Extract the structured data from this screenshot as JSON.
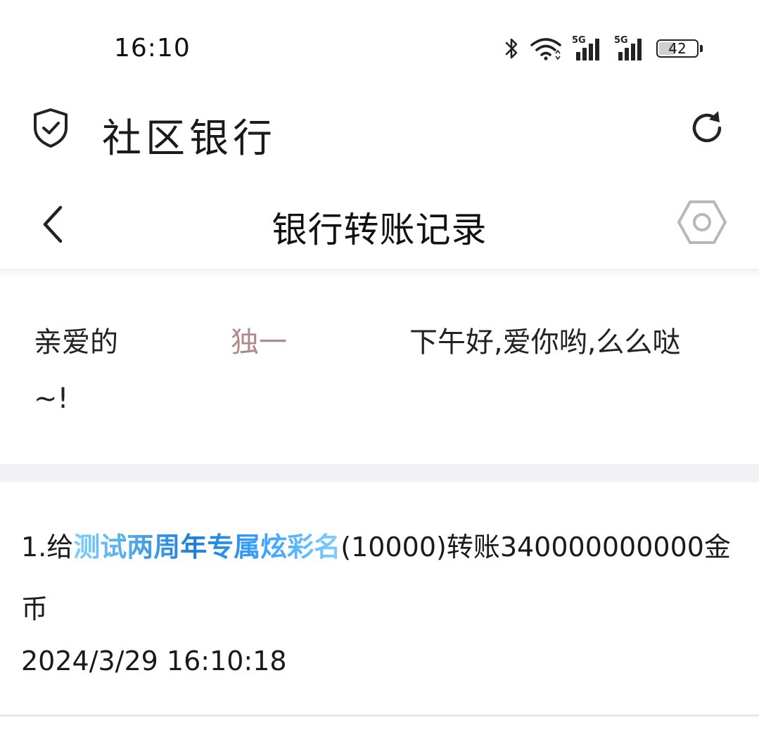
{
  "status_bar": {
    "time": "16:10",
    "network_label_1": "5G",
    "network_label_2": "5G",
    "battery_level": "42",
    "battery_fraction": 0.42
  },
  "app": {
    "title": "社区银行"
  },
  "nav": {
    "title": "银行转账记录"
  },
  "greeting": {
    "prefix": "亲爱的",
    "name": "独一",
    "message": "下午好,爱你哟,么么哒",
    "tail": "~!"
  },
  "records": [
    {
      "prefix": "1.给",
      "recipient": "测试两周年专属炫彩名",
      "detail": "(10000)转账340000000000金币",
      "timestamp": "2024/3/29 16:10:18"
    }
  ],
  "colors": {
    "greeting_name": "#b08a8a",
    "recipient_gradient_dark": "#1e7fd6",
    "recipient_gradient_light": "#7fd0ff",
    "separator": "#f2f2f5"
  }
}
